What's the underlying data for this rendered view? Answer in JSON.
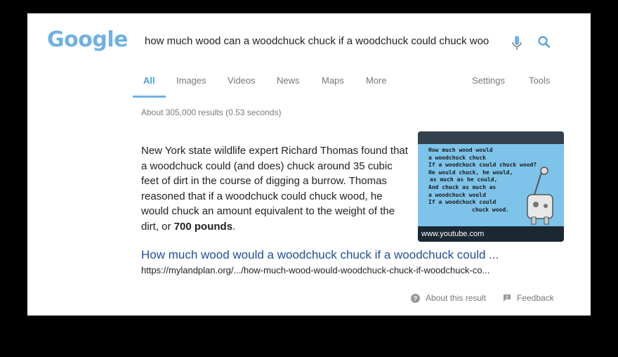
{
  "header": {
    "logo": "Google",
    "search_query": "how much wood can a woodchuck chuck if a woodchuck could chuck woo"
  },
  "tabs": [
    {
      "label": "All"
    },
    {
      "label": "Images"
    },
    {
      "label": "Videos"
    },
    {
      "label": "News"
    },
    {
      "label": "Maps"
    },
    {
      "label": "More"
    },
    {
      "label": "Settings"
    },
    {
      "label": "Tools"
    }
  ],
  "result_stats": "About 305,000 results (0.53 seconds)",
  "featured_snippet": {
    "text_before": "New York state wildlife expert Richard Thomas found that a woodchuck could (and does) chuck around 35 cubic feet of dirt in the course of digging a burrow. Thomas reasoned that if a woodchuck could chuck wood, he would chuck an amount equivalent to the weight of the dirt, or ",
    "bold": "700 pounds",
    "text_after": ".",
    "thumbnail": {
      "lines": [
        "How much wood would",
        "a woodchuck chuck",
        "If a woodchuck could chuck wood?",
        "He would chuck, he would,",
        "as much as he could,",
        "And chuck as much as",
        "a woodchuck would",
        "If a woodchuck could",
        "chuck wood."
      ],
      "caption": "www.youtube.com"
    },
    "title": "How much wood would a woodchuck chuck if a woodchuck could ...",
    "url": "https://mylandplan.org/.../how-much-wood-would-woodchuck-chuck-if-woodchuck-co..."
  },
  "footer": {
    "about": "About this result",
    "feedback": "Feedback"
  },
  "colors": {
    "accent": "#6fb1e3",
    "link": "#1f4f9a"
  }
}
